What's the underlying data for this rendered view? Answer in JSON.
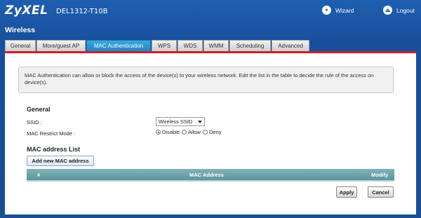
{
  "header": {
    "brand": "ZyXEL",
    "model": "DEL1312-T10B",
    "wizard_label": "Wizard",
    "logout_label": "Logout"
  },
  "page_title": "Wireless",
  "tabs": [
    {
      "label": "General"
    },
    {
      "label": "More/guest AP"
    },
    {
      "label": "MAC Authentication",
      "active": true
    },
    {
      "label": "WPS"
    },
    {
      "label": "WDS"
    },
    {
      "label": "WMM"
    },
    {
      "label": "Scheduling"
    },
    {
      "label": "Advanced"
    }
  ],
  "info_text": "MAC Authentication can allow or block the access of the device(s) to your wireless network. Edit the list in the table to decide the rule of the access on device(s).",
  "general": {
    "heading": "General",
    "ssid_label": "SSID :",
    "ssid_value": "Wireless SSID",
    "restrict_label": "MAC Restrict Mode :",
    "restrict_options": [
      "Disable",
      "Allow",
      "Deny"
    ],
    "restrict_selected": "Disable"
  },
  "mac_list": {
    "heading": "MAC address List",
    "add_button": "Add new MAC address",
    "columns": [
      "#",
      "MAC Address",
      "Modify"
    ]
  },
  "actions": {
    "apply": "Apply",
    "cancel": "Cancel"
  },
  "colors": {
    "header_bg": "#1f5fb0",
    "active_tab": "#2a96d2",
    "accent_line": "#cc1f26",
    "table_header": "#6ea4aa"
  }
}
